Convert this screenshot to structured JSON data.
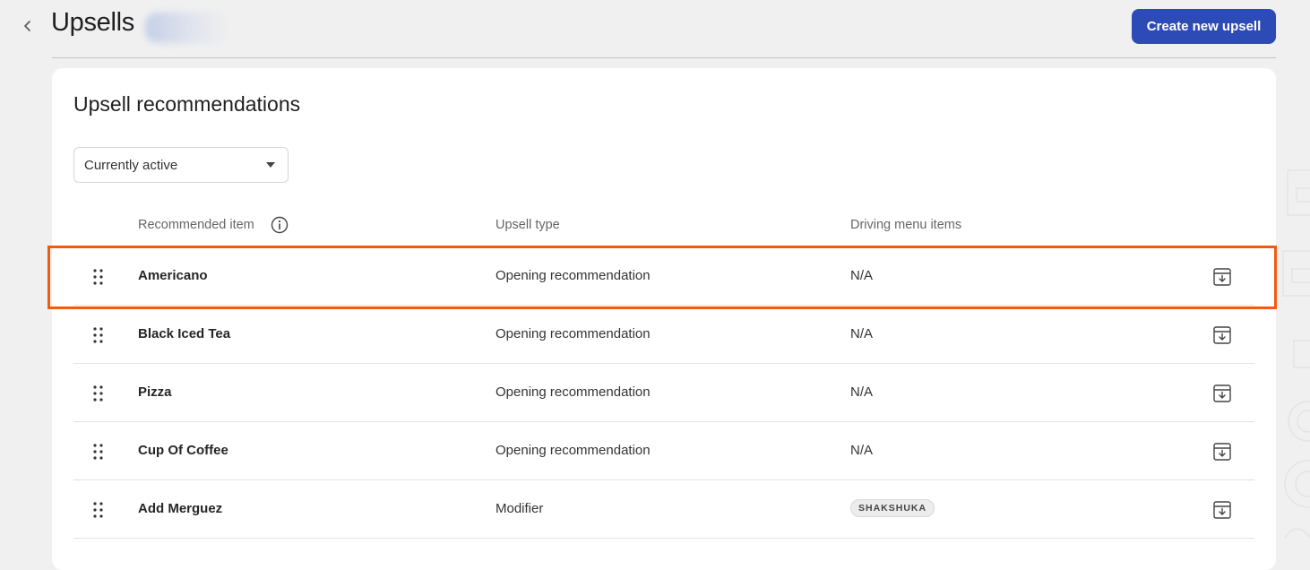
{
  "header": {
    "back_icon": "chevron-left-icon",
    "title": "Upsells",
    "create_button_label": "Create new upsell",
    "accent_color": "#2d4bb6"
  },
  "card": {
    "title": "Upsell recommendations",
    "filter": {
      "selected": "Currently active"
    }
  },
  "table": {
    "columns": [
      "Recommended item",
      "Upsell type",
      "Driving menu items"
    ],
    "rows": [
      {
        "item": "Americano",
        "type": "Opening recommendation",
        "driving": "N/A",
        "driving_kind": "text",
        "highlighted": true
      },
      {
        "item": "Black Iced Tea",
        "type": "Opening recommendation",
        "driving": "N/A",
        "driving_kind": "text",
        "highlighted": false
      },
      {
        "item": "Pizza",
        "type": "Opening recommendation",
        "driving": "N/A",
        "driving_kind": "text",
        "highlighted": false
      },
      {
        "item": "Cup Of Coffee",
        "type": "Opening recommendation",
        "driving": "N/A",
        "driving_kind": "text",
        "highlighted": false
      },
      {
        "item": "Add Merguez",
        "type": "Modifier",
        "driving": "SHAKSHUKA",
        "driving_kind": "chip",
        "highlighted": false
      }
    ]
  },
  "highlight_color": "#f05a13"
}
